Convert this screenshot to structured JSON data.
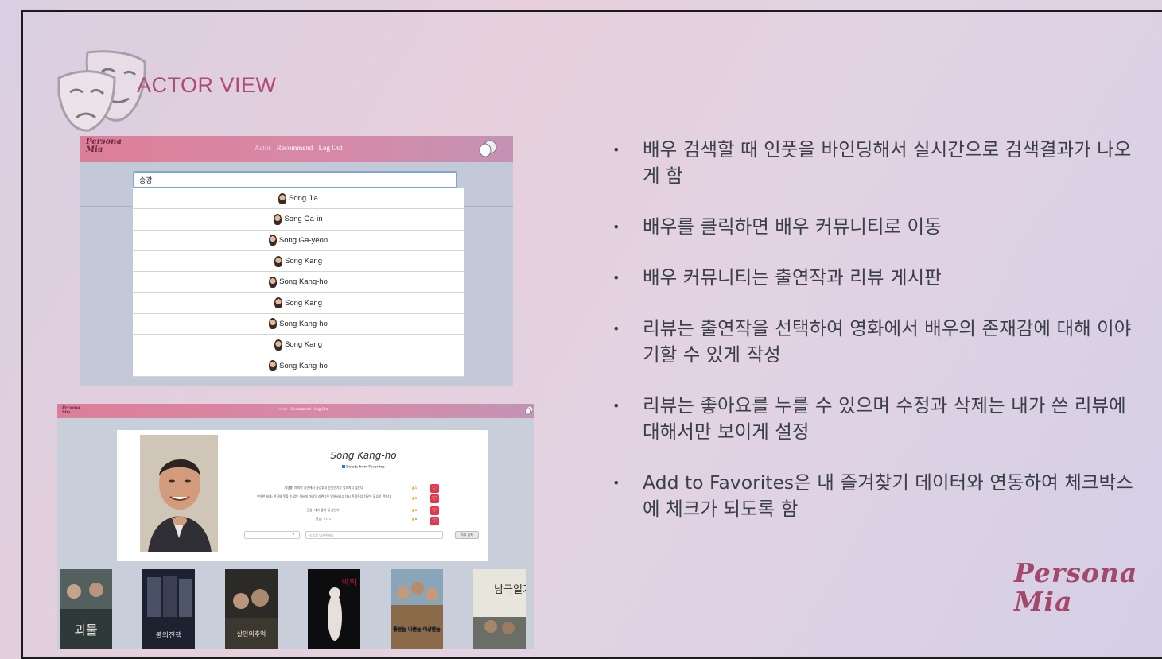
{
  "slide": {
    "title": "ACTOR VIEW",
    "logo_line1": "Persona",
    "logo_line2": "Mia"
  },
  "app": {
    "brand_line1": "Persona",
    "brand_line2": "Mia",
    "nav": {
      "actor": "Actor",
      "recommend": "Recommend",
      "logout": "Log Out"
    }
  },
  "search": {
    "value": "송강",
    "results": [
      "Song Jia",
      "Song Ga-in",
      "Song Ga-yeon",
      "Song Kang",
      "Song Kang-ho",
      "Song Kang",
      "Song Kang-ho",
      "Song Kang",
      "Song Kang-ho"
    ]
  },
  "actor_page": {
    "name": "Song Kang-ho",
    "favorite_label": "Delete from Favorites",
    "reviews": [
      {
        "text": "기생충: 마지막 장면에서 송강호의 눈빛연기가 잊혀지지 않는다",
        "likes": "1"
      },
      {
        "text": "우아한 세계: 한국의 웃을 수 없는 아버지 마지막 라면그릇 엎어버리고 다시 주섬주섬 치우는 모습이 짠하다",
        "likes": "0"
      },
      {
        "text": "관상: 내가 왕이 될 상인가?",
        "likes": "0"
      },
      {
        "text": "관상: ㄴㄴㄴ",
        "likes": "0"
      }
    ],
    "review_placeholder": "리뷰를 남겨주세요",
    "submit_label": "리뷰 등록",
    "poster_titles": [
      "괴물",
      "불의전쟁",
      "살인의추억",
      "박쥐",
      "좋은놈 나쁜놈 이상한놈",
      "남극일기"
    ]
  },
  "bullets": [
    "배우 검색할 때 인풋을 바인딩해서 실시간으로 검색결과가 나오게 함",
    "배우를 클릭하면 배우 커뮤니티로 이동",
    "배우 커뮤니티는 출연작과 리뷰 게시판",
    "리뷰는 출연작을 선택하여 영화에서 배우의 존재감에 대해 이야기할 수 있게 작성",
    "리뷰는 좋아요를 누를 수 있으며 수정과 삭제는 내가 쓴 리뷰에 대해서만 보이게 설정",
    "Add to Favorites은 내 즐겨찾기 데이터와 연동하여 체크박스에 체크가 되도록 함"
  ]
}
